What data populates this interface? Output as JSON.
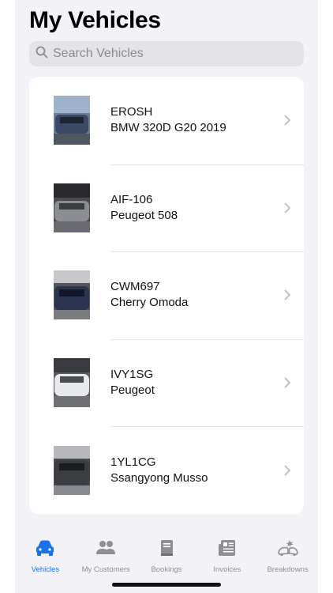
{
  "header": {
    "title": "My Vehicles"
  },
  "search": {
    "placeholder": "Search Vehicles",
    "icon": "search-icon"
  },
  "vehicles": [
    {
      "plate": "EROSH",
      "model": "BMW 320D  G20 2019",
      "photo_color": "#3a4a66"
    },
    {
      "plate": "AIF-106",
      "model": "Peugeot 508",
      "photo_color": "#8a8d92"
    },
    {
      "plate": "CWM697",
      "model": "Cherry Omoda",
      "photo_color": "#2b3550"
    },
    {
      "plate": "IVY1SG",
      "model": "Peugeot",
      "photo_color": "#e8e9ec"
    },
    {
      "plate": "1YL1CG",
      "model": "Ssangyong Musso",
      "photo_color": "#3b3d42"
    }
  ],
  "tabbar": {
    "tabs": [
      {
        "label": "Vehicles",
        "icon": "car-icon",
        "active": true
      },
      {
        "label": "My Customers",
        "icon": "people-icon",
        "active": false
      },
      {
        "label": "Bookings",
        "icon": "book-icon",
        "active": false
      },
      {
        "label": "Invoices",
        "icon": "newspaper-icon",
        "active": false
      },
      {
        "label": "Breakdowns",
        "icon": "car-crash-icon",
        "active": false
      }
    ]
  },
  "colors": {
    "accent": "#1a73e8",
    "inactive": "#8e8e93",
    "background": "#f2f2f7"
  }
}
